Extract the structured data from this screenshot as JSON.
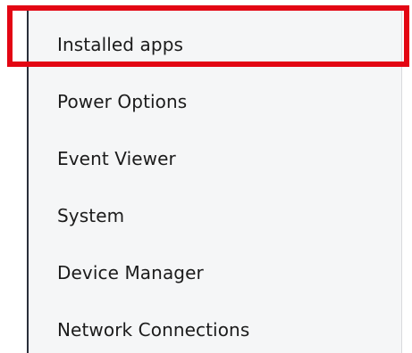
{
  "menu": {
    "items": [
      {
        "label": "Installed apps"
      },
      {
        "label": "Power Options"
      },
      {
        "label": "Event Viewer"
      },
      {
        "label": "System"
      },
      {
        "label": "Device Manager"
      },
      {
        "label": "Network Connections"
      }
    ]
  },
  "highlight": {
    "color": "#e30613",
    "target": "Installed apps"
  }
}
